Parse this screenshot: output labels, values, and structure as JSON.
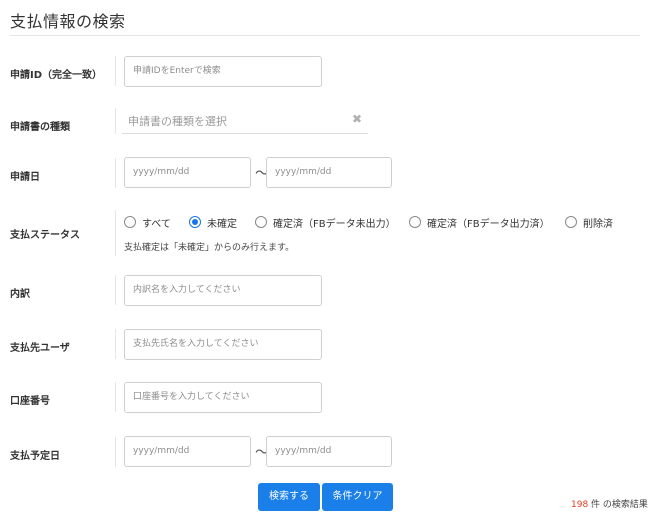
{
  "page": {
    "title": "支払情報の検索"
  },
  "form": {
    "application_id": {
      "label": "申請ID（完全一致）",
      "placeholder": "申請IDをEnterで検索"
    },
    "application_type": {
      "label": "申請書の種類",
      "placeholder": "申請書の種類を選択",
      "clear_icon": "✖"
    },
    "application_date": {
      "label": "申請日",
      "from_placeholder": "yyyy/mm/dd",
      "separator": "〜",
      "to_placeholder": "yyyy/mm/dd"
    },
    "payment_status": {
      "label": "支払ステータス",
      "options": [
        {
          "label": "すべて",
          "selected": false
        },
        {
          "label": "未確定",
          "selected": true
        },
        {
          "label": "確定済（FBデータ未出力）",
          "selected": false
        },
        {
          "label": "確定済（FBデータ出力済）",
          "selected": false
        },
        {
          "label": "削除済",
          "selected": false
        }
      ],
      "note": "支払確定は「未確定」からのみ行えます。"
    },
    "breakdown": {
      "label": "内訳",
      "placeholder": "内訳名を入力してください"
    },
    "payee_user": {
      "label": "支払先ユーザ",
      "placeholder": "支払先氏名を入力してください"
    },
    "account_number": {
      "label": "口座番号",
      "placeholder": "口座番号を入力してください"
    },
    "scheduled_payment_date": {
      "label": "支払予定日",
      "from_placeholder": "yyyy/mm/dd",
      "separator": "〜",
      "to_placeholder": "yyyy/mm/dd"
    }
  },
  "actions": {
    "search_label": "検索する",
    "clear_label": "条件クリア"
  },
  "results": {
    "count": "198",
    "suffix": " 件 の検索結果"
  },
  "colors": {
    "accent": "#1a7fe8",
    "count": "#e03c1f"
  }
}
